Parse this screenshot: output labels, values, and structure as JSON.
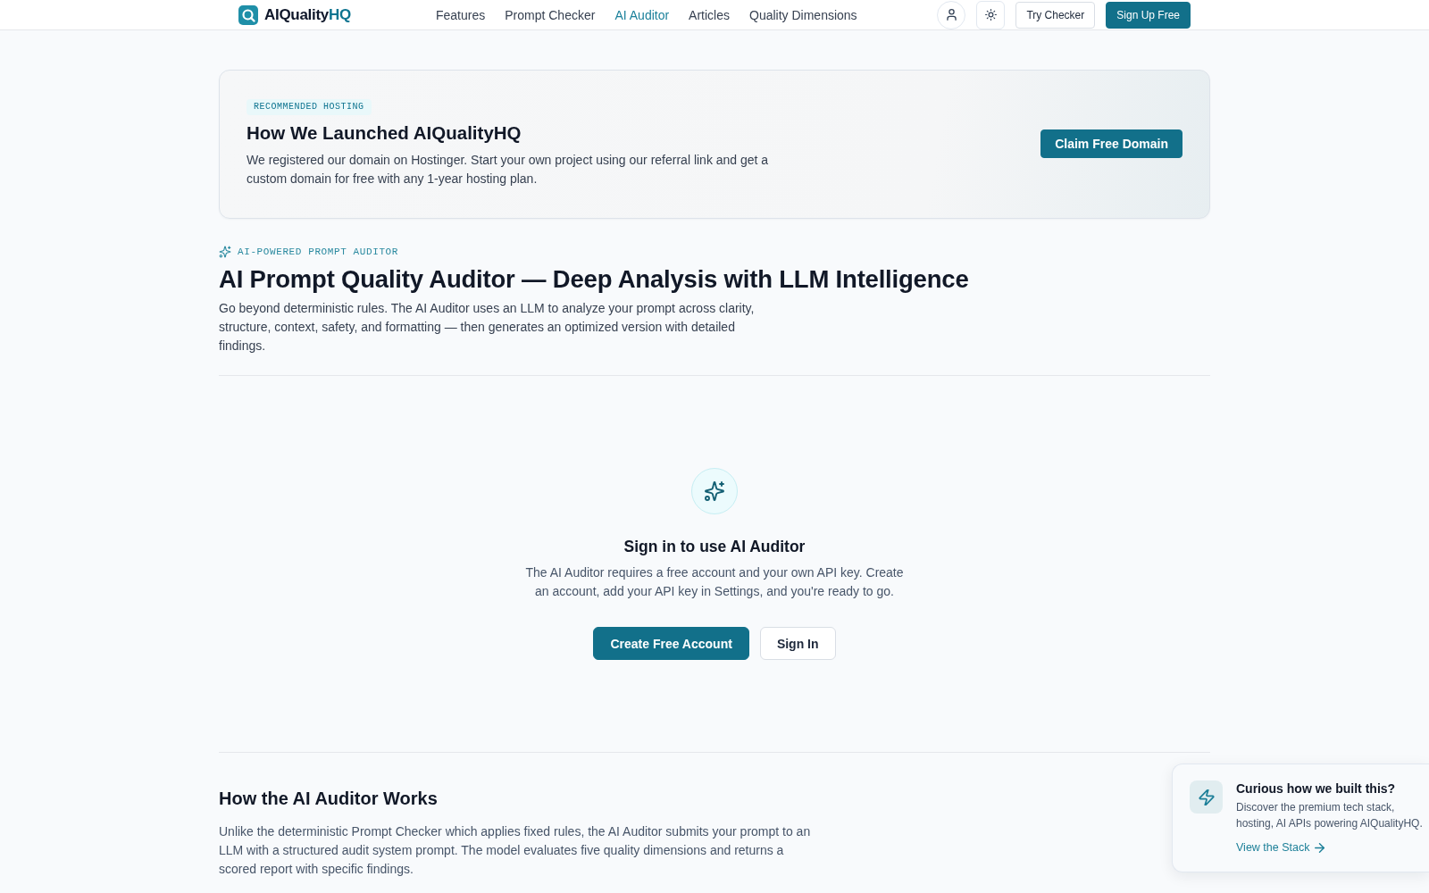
{
  "header": {
    "logo": {
      "name": "AIQuality",
      "accent": "HQ"
    },
    "nav": [
      {
        "label": "Features",
        "selected": false
      },
      {
        "label": "Prompt Checker",
        "selected": false
      },
      {
        "label": "AI Auditor",
        "selected": true
      },
      {
        "label": "Articles",
        "selected": false
      },
      {
        "label": "Quality Dimensions",
        "selected": false
      }
    ],
    "buttons": [
      {
        "label": "Try Checker",
        "kind": "outline"
      },
      {
        "label": "Sign Up Free",
        "kind": "primary"
      }
    ]
  },
  "promo": {
    "badge": "RECOMMENDED HOSTING",
    "title": "How We Launched AIQualityHQ",
    "text": "We registered our domain on Hostinger. Start your own project using our referral link and get a custom domain for free with any 1-year hosting plan.",
    "button": "Claim Free Domain"
  },
  "hero": {
    "eyebrow": "AI-POWERED PROMPT AUDITOR",
    "title": "AI Prompt Quality Auditor — Deep Analysis with LLM Intelligence",
    "text": "Go beyond deterministic rules. The AI Auditor uses an LLM to analyze your prompt across clarity, structure, context, safety, and formatting — then generates an optimized version with detailed findings."
  },
  "signin_panel": {
    "title": "Sign in to use AI Auditor",
    "text": "The AI Auditor requires a free account and your own API key. Create an account, add your API key in Settings, and you're ready to go.",
    "buttons": [
      {
        "label": "Create Free Account",
        "kind": "primary"
      },
      {
        "label": "Sign In",
        "kind": "outline"
      }
    ]
  },
  "how_it_works": {
    "title": "How the AI Auditor Works",
    "text": "Unlike the deterministic Prompt Checker which applies fixed rules, the AI Auditor submits your prompt to an LLM with a structured audit system prompt. The model evaluates five quality dimensions and returns a scored report with specific findings."
  },
  "stack_popup": {
    "title": "Curious how we built this?",
    "text": "Discover the premium tech stack, hosting, AI APIs powering AIQualityHQ.",
    "link": "View the Stack"
  }
}
